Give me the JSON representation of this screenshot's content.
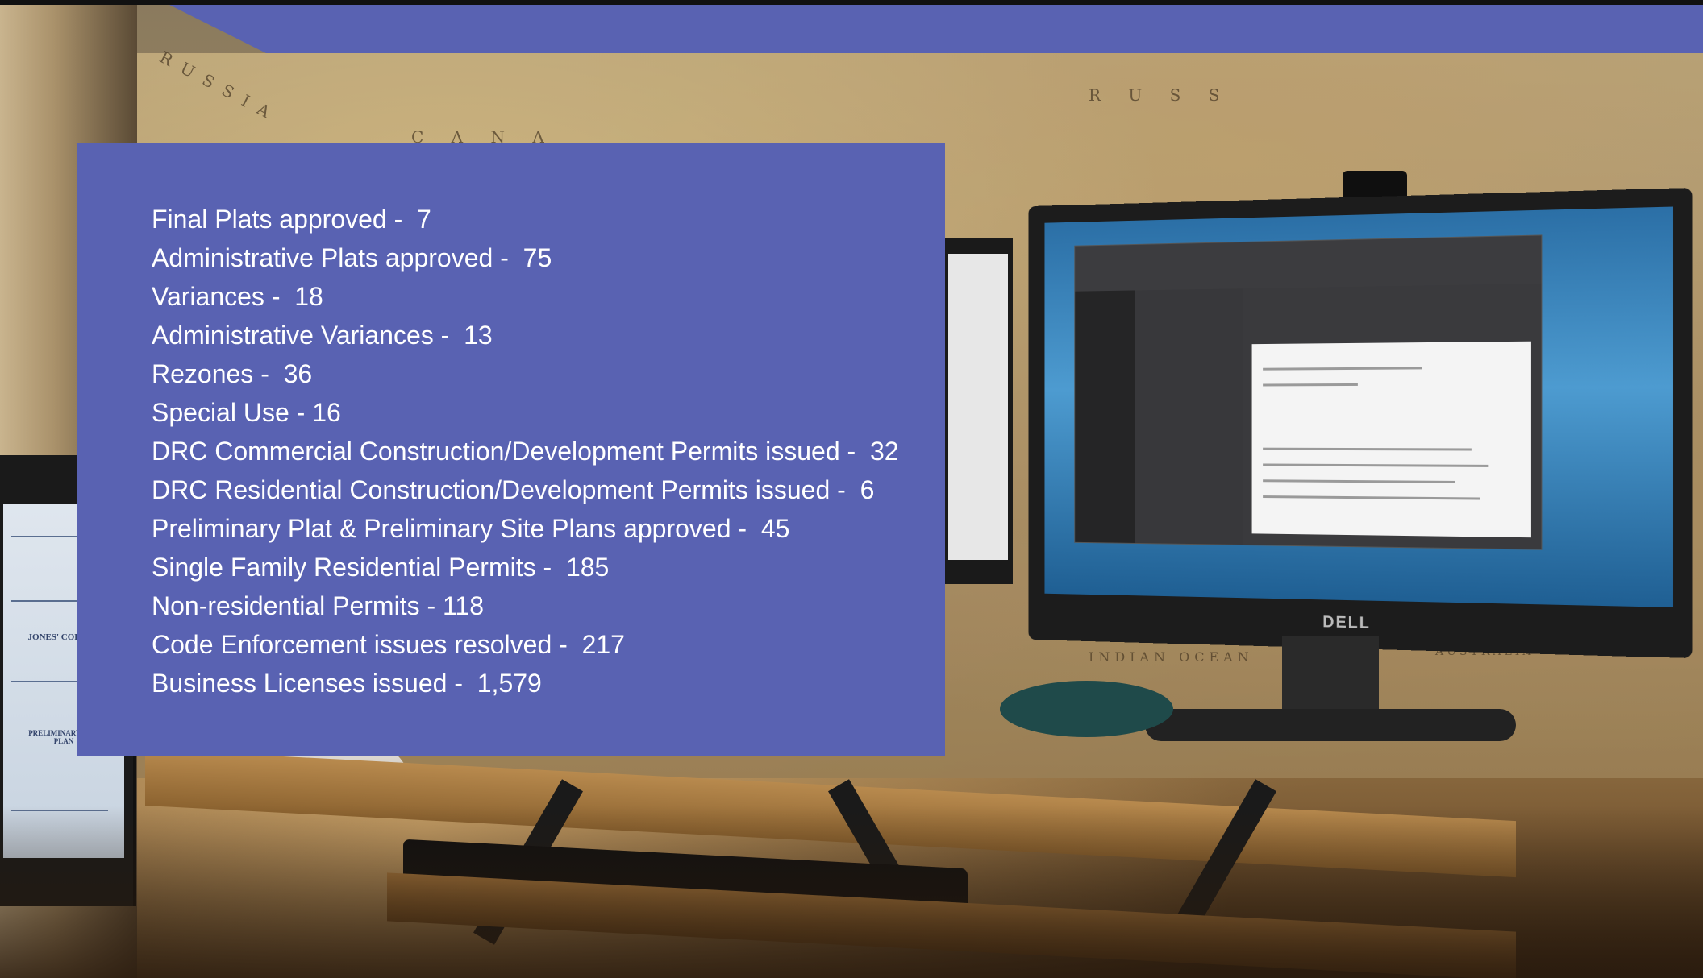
{
  "stats": {
    "items": [
      {
        "text": "Final Plats approved -  7"
      },
      {
        "text": "Administrative Plats approved -  75"
      },
      {
        "text": "Variances -  18"
      },
      {
        "text": "Administrative Variances -  13"
      },
      {
        "text": "Rezones -  36"
      },
      {
        "text": "Special Use - 16"
      },
      {
        "text": "DRC Commercial Construction/Development Permits issued -  32"
      },
      {
        "text": "DRC Residential Construction/Development Permits issued -  6"
      },
      {
        "text": "Preliminary Plat & Preliminary Site Plans approved -  45"
      },
      {
        "text": "Single Family Residential Permits -  185"
      },
      {
        "text": "Non-residential Permits - 118"
      },
      {
        "text": "Code Enforcement issues resolved -  217"
      },
      {
        "text": "Business Licenses issued -  1,579"
      }
    ]
  },
  "colors": {
    "panel": "#5962b2",
    "text": "#ffffff"
  },
  "background": {
    "map_labels": [
      "RUSSIA",
      "R U S S",
      "C A N A",
      "INDIAN OCEAN",
      "AUSTRALIA"
    ],
    "monitor_brand": "DELL",
    "left_screen": {
      "project_name": "JONES' CORNER",
      "plan_title": "PRELIMINARY SITE PLAN"
    }
  }
}
